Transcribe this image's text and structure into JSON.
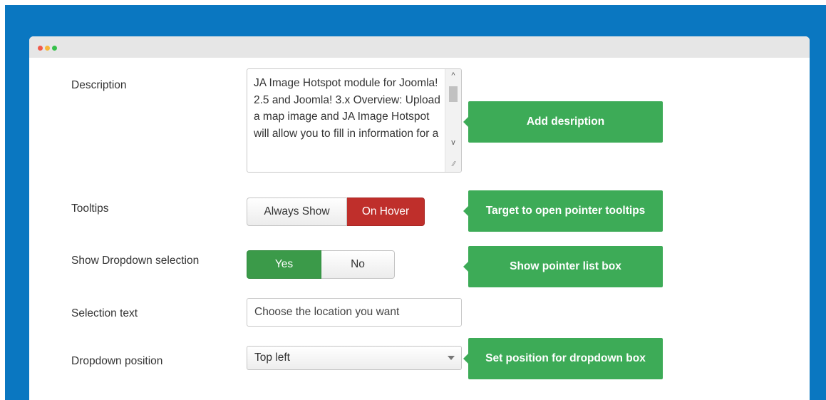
{
  "form": {
    "description": {
      "label": "Description",
      "text": "JA Image Hotspot module for Joomla! 2.5 and Joomla! 3.x Overview: Upload a map image and JA Image Hotspot will allow you to fill in information for a"
    },
    "tooltips": {
      "label": "Tooltips",
      "options": [
        "Always Show",
        "On Hover"
      ],
      "selected": "On Hover"
    },
    "dropdown_selection": {
      "label": "Show Dropdown selection",
      "options": [
        "Yes",
        "No"
      ],
      "selected": "Yes"
    },
    "selection_text": {
      "label": "Selection text",
      "value": "Choose the location you want"
    },
    "dropdown_position": {
      "label": "Dropdown position",
      "value": "Top left"
    }
  },
  "callouts": {
    "description": "Add desription",
    "tooltips": "Target to open pointer tooltips",
    "dropdown": "Show pointer list box",
    "position": "Set position for dropdown box"
  },
  "colors": {
    "background": "#0a77c1",
    "accent_green": "#3dab57",
    "active_red": "#bf2f2b",
    "active_green": "#3b9a49"
  }
}
